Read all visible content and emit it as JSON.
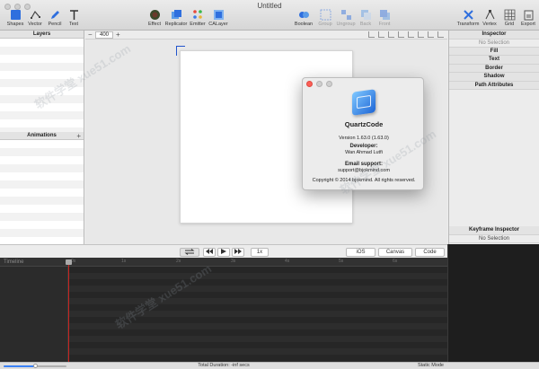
{
  "window": {
    "title": "Untitled"
  },
  "toolbar": {
    "shapes": "Shapes",
    "vector": "Vector",
    "pencil": "Pencil",
    "text": "Text",
    "effect": "Effect",
    "replicator": "Replicator",
    "emitter": "Emitter",
    "calayer": "CALayer",
    "boolean": "Boolean",
    "group": "Group",
    "ungroup": "Ungroup",
    "back": "Back",
    "front": "Front",
    "transform": "Transform",
    "vertex": "Vertex",
    "grid": "Grid",
    "export": "Export"
  },
  "layers": {
    "title": "Layers"
  },
  "animations": {
    "title": "Animations",
    "add": "+"
  },
  "canvas": {
    "zoom_value": "400",
    "zoom_minus": "−",
    "zoom_plus": "+"
  },
  "inspector": {
    "title": "Inspector",
    "selection": "No Selection",
    "sections": [
      "Fill",
      "Text",
      "Border",
      "Shadow",
      "Path Attributes"
    ]
  },
  "keyframe_inspector": {
    "title": "Keyframe Inspector",
    "selection": "No Selection"
  },
  "about": {
    "app_name": "QuartzCode",
    "version": "Version 1.63.0 (1.63.0)",
    "developer_heading": "Developer:",
    "developer_name": "Wan Ahmad Lutfi",
    "email_heading": "Email support:",
    "email": "support@bjokmind.com",
    "copyright": "Copyright © 2014 bjokmind. All rights reserved."
  },
  "playback": {
    "speed": "1x",
    "platform": "iOS",
    "canvas_btn": "Canvas",
    "code_btn": "Code"
  },
  "timeline": {
    "label": "Timeline",
    "ticks": [
      "0s",
      "1s",
      "2s",
      "3s",
      "4s",
      "5s",
      "6s"
    ]
  },
  "status": {
    "duration": "Total Duration: -inf secs",
    "mode": "Static Mode",
    "zoom_level": 0.5
  },
  "colors": {
    "accent": "#2f6fde",
    "playhead": "#c8231f"
  }
}
